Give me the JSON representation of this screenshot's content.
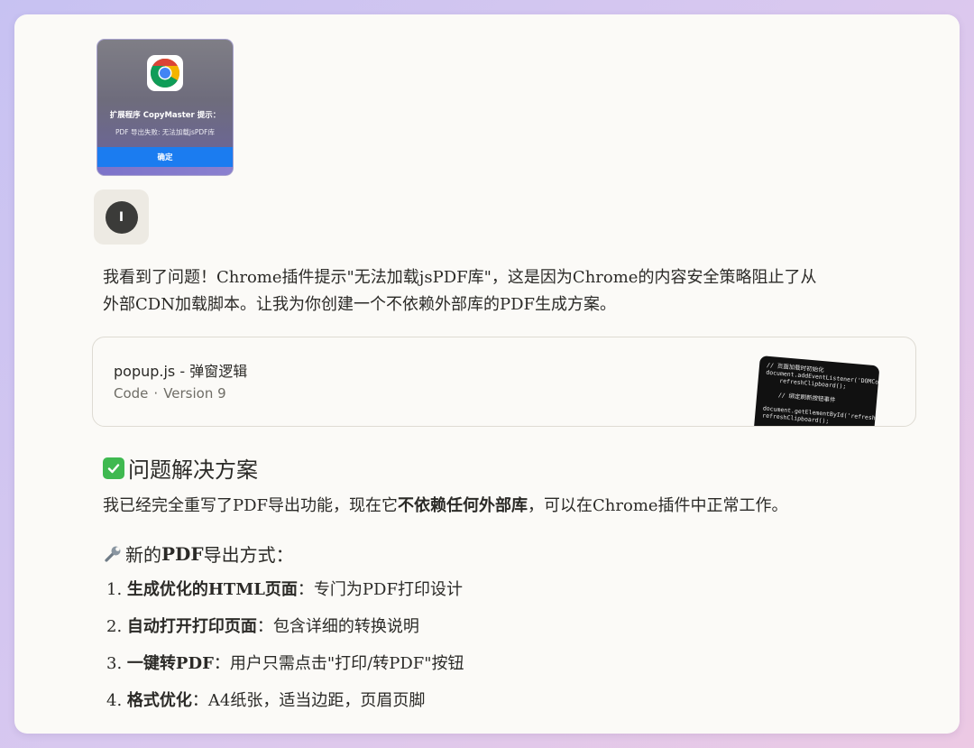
{
  "dialog_screenshot": {
    "title": "扩展程序 CopyMaster 提示：",
    "message": "PDF 导出失败: 无法加载jsPDF库",
    "ok_label": "确定"
  },
  "user": {
    "avatar_initial": "I"
  },
  "assistant": {
    "intro_line1": "我看到了问题！Chrome插件提示\"无法加载jsPDF库\"，这是因为Chrome的内容安全策略阻止了从",
    "intro_line2": "外部CDN加载脚本。让我为你创建一个不依赖外部库的PDF生成方案。",
    "artifact": {
      "title": "popup.js - 弹窗逻辑",
      "type": "Code",
      "separator": "·",
      "version": "Version 9",
      "code_preview": "// 页面加载时初始化\ndocument.addEventListener('DOMContentLoaded'\n    refreshClipboard();\n\n    // 绑定刷新按钮事件\n\ndocument.getElementById('refresh\nrefreshClipboard();\n\n    // 绑定格式按钮事件"
    },
    "section_title": "问题解决方案",
    "summary_pre": "我已经完全重写了PDF导出功能，现在它",
    "summary_bold": "不依赖任何外部库",
    "summary_post": "，可以在Chrome插件中正常工作。",
    "method_title_pre": "新的",
    "method_title_bold": "PDF",
    "method_title_post": "导出方式：",
    "steps": [
      {
        "num": "1.",
        "bold": "生成优化的HTML页面",
        "text": "：专门为PDF打印设计"
      },
      {
        "num": "2.",
        "bold": "自动打开打印页面",
        "text": "：包含详细的转换说明"
      },
      {
        "num": "3.",
        "bold": "一键转PDF",
        "text": "：用户只需点击\"打印/转PDF\"按钮"
      },
      {
        "num": "4.",
        "bold": "格式优化",
        "text": "：A4纸张，适当边距，页眉页脚"
      }
    ]
  },
  "colors": {
    "background_start": "#c7c2f2",
    "background_end": "#ecc9e4",
    "card": "#fbfaf7",
    "dialog_button": "#1b7cf0",
    "check": "#3fb950"
  }
}
